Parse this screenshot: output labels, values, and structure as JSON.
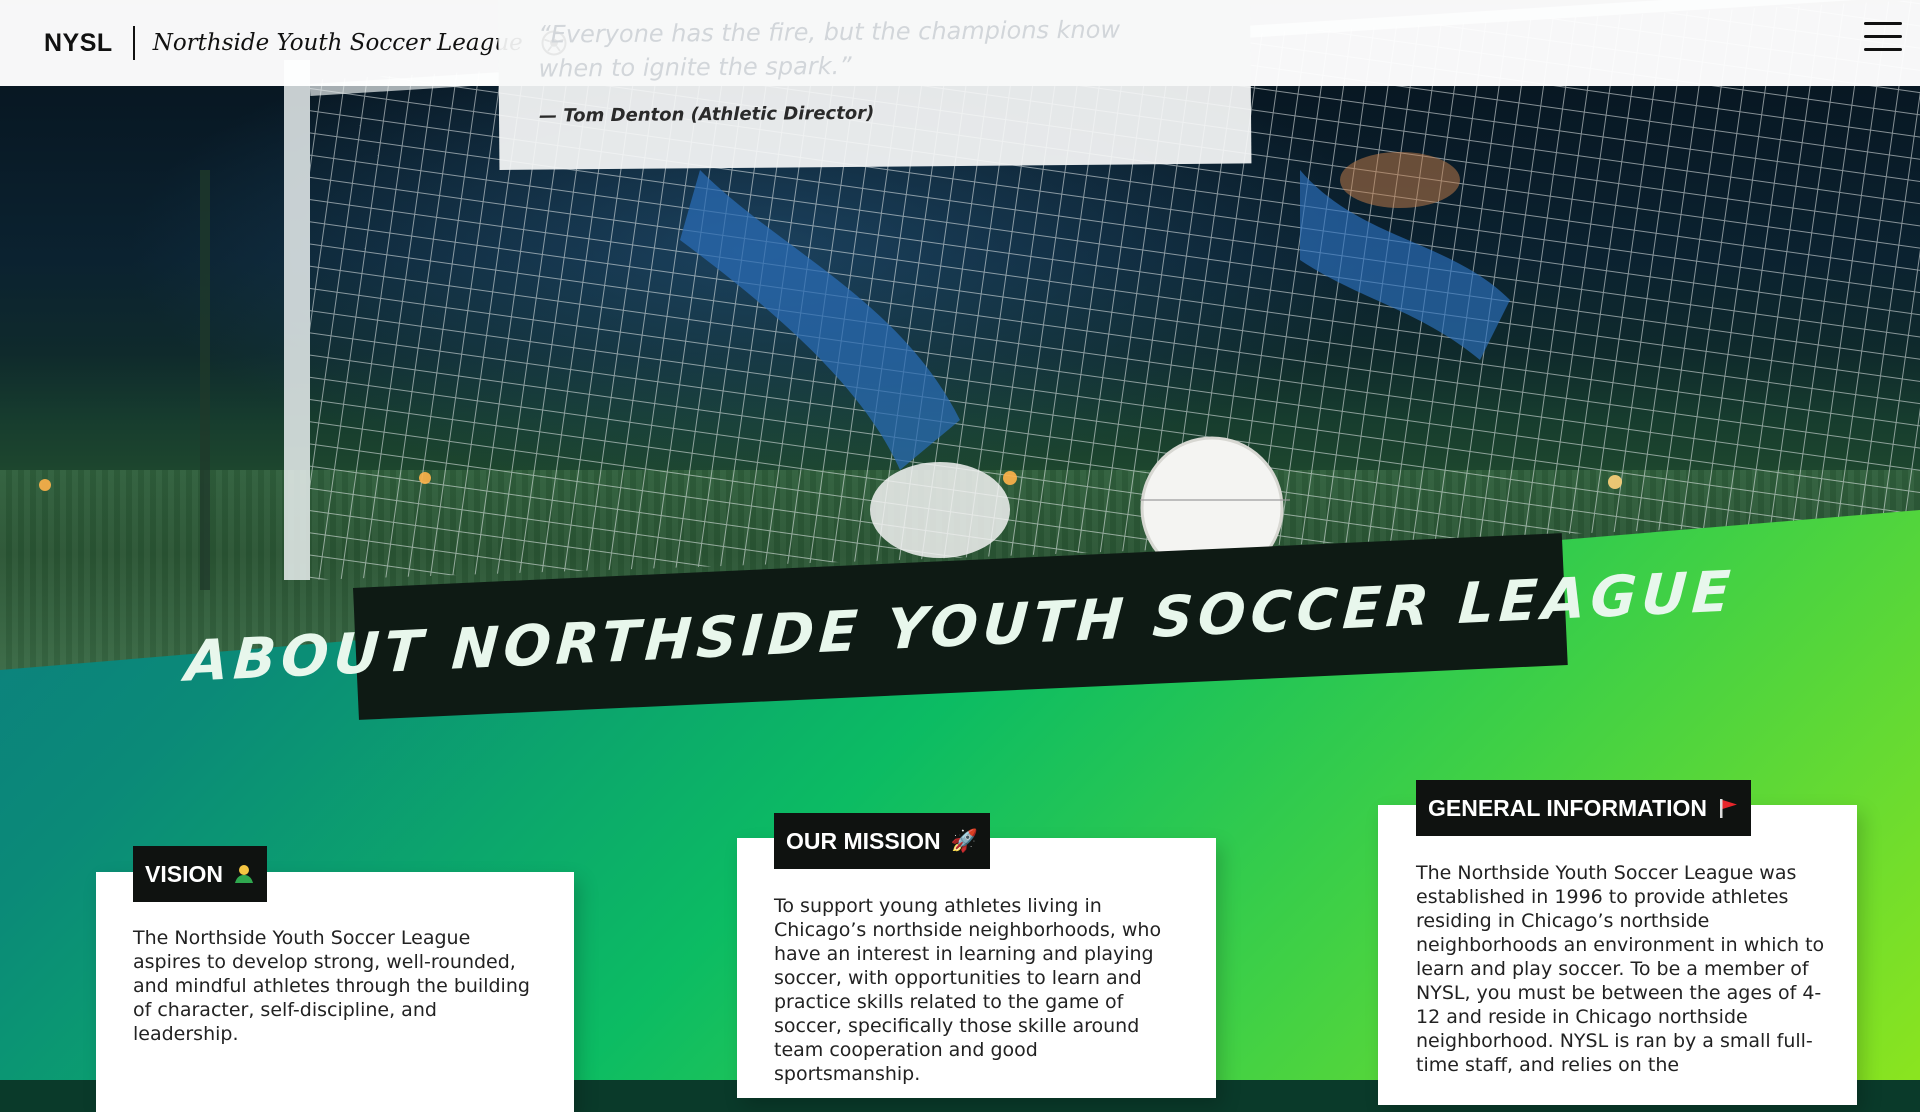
{
  "nav": {
    "brand_short": "NYSL",
    "brand_full": "Northside Youth Soccer League",
    "logo_icon": "soccer-ball-icon",
    "menu_icon": "hamburger-menu-icon"
  },
  "quote": {
    "text": "“Everyone has the fire, but the champions know when to ignite the spark.”",
    "author": "— Tom Denton (Athletic Director)"
  },
  "banner": {
    "title": "About Northside Youth Soccer League"
  },
  "cards": {
    "vision": {
      "label": "VISION",
      "icon": "person-shrug-icon",
      "body": "The Northside Youth Soccer League aspires to develop strong, well-rounded, and mindful athletes through the building of character, self-discipline, and leadership."
    },
    "mission": {
      "label": "OUR MISSION",
      "icon": "rocket-icon",
      "body": "To support young athletes living in Chicago’s northside neighborhoods, who have an interest in learning and playing soccer, with opportunities to learn and practice skills related to the game of soccer, specifically those skille around team cooperation and good sportsmanship."
    },
    "general": {
      "label": "GENERAL INFORMATION",
      "icon": "red-flag-icon",
      "body": "The Northside Youth Soccer League was established in 1996 to provide athletes residing in Chicago’s northside neighborhoods an environment in which to learn and play soccer. To be a member of NYSL, you must be between the ages of 4-12 and reside in Chicago northside neighborhood. NYSL is ran by a small full-time staff, and relies on the"
    }
  },
  "colors": {
    "gradient_start": "#0d6f87",
    "gradient_mid": "#0cbc63",
    "gradient_end": "#8be41f",
    "banner_bg": "#0e1a14",
    "banner_text": "#e8f7ec"
  }
}
